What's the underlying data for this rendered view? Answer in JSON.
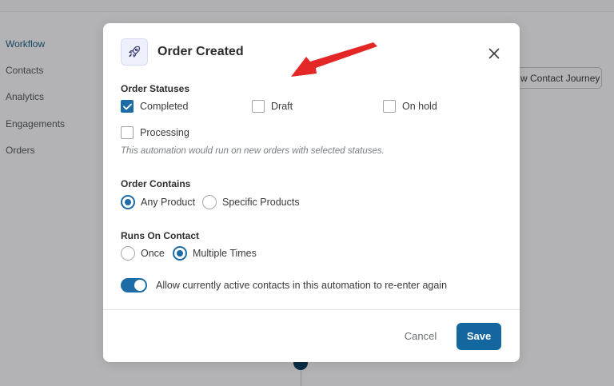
{
  "sidebar": {
    "items": [
      {
        "label": "Workflow",
        "active": true
      },
      {
        "label": "Contacts"
      },
      {
        "label": "Analytics"
      },
      {
        "label": "Engagements"
      },
      {
        "label": "Orders"
      }
    ]
  },
  "background": {
    "journey_button_label": "w Contact Journey"
  },
  "modal": {
    "icon": "rocket-icon",
    "title": "Order Created",
    "close_icon": "close-icon",
    "order_statuses": {
      "label": "Order Statuses",
      "options": [
        {
          "label": "Completed",
          "checked": true
        },
        {
          "label": "Draft",
          "checked": false
        },
        {
          "label": "On hold",
          "checked": false
        },
        {
          "label": "Processing",
          "checked": false
        }
      ],
      "hint": "This automation would run on new orders with selected statuses."
    },
    "order_contains": {
      "label": "Order Contains",
      "options": [
        {
          "label": "Any Product",
          "selected": true
        },
        {
          "label": "Specific Products",
          "selected": false
        }
      ]
    },
    "runs_on_contact": {
      "label": "Runs On Contact",
      "options": [
        {
          "label": "Once",
          "selected": false
        },
        {
          "label": "Multiple Times",
          "selected": true
        }
      ]
    },
    "reenter_toggle": {
      "label": "Allow currently active contacts in this automation to re-enter again",
      "on": true
    },
    "footer": {
      "cancel_label": "Cancel",
      "save_label": "Save"
    }
  },
  "colors": {
    "accent": "#1e6ca5",
    "save_button": "#14679e",
    "annotation_arrow": "#e32727",
    "backdrop": "#b3b3b5"
  }
}
